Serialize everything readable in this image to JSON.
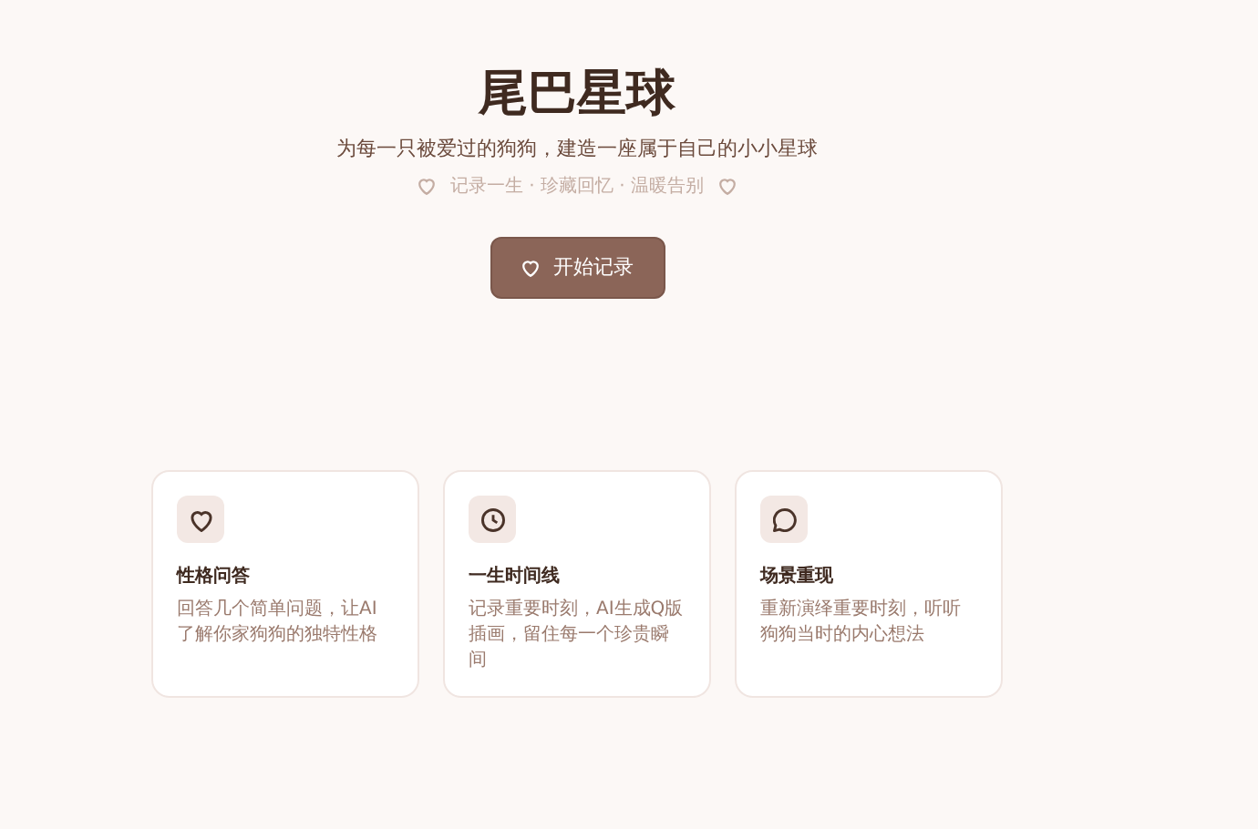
{
  "hero": {
    "title": "尾巴星球",
    "subtitle": "为每一只被爱过的狗狗，建造一座属于自己的小小星球",
    "tagline": "记录一生 · 珍藏回忆 · 温暖告别",
    "button": "开始记录"
  },
  "features": [
    {
      "title": "性格问答",
      "description": "回答几个简单问题，让AI了解你家狗狗的独特性格"
    },
    {
      "title": "一生时间线",
      "description": "记录重要时刻，AI生成Q版插画，留住每一个珍贵瞬间"
    },
    {
      "title": "场景重现",
      "description": "重新演绎重要时刻，听听狗狗当时的内心想法"
    }
  ]
}
